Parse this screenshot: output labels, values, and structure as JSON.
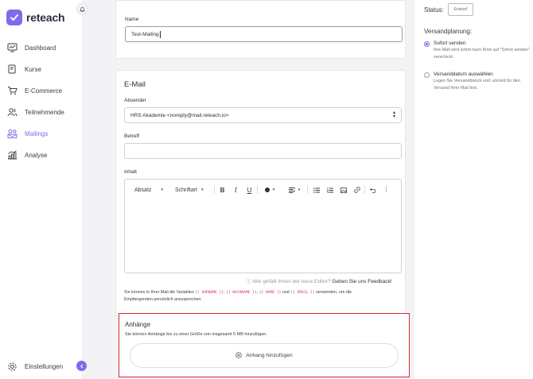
{
  "brand": {
    "name": "reteach"
  },
  "sidebar": {
    "items": [
      {
        "label": "Dashboard",
        "icon": "dashboard-icon"
      },
      {
        "label": "Kurse",
        "icon": "book-icon"
      },
      {
        "label": "E-Commerce",
        "icon": "cart-icon"
      },
      {
        "label": "Teilnehmende",
        "icon": "users-icon"
      },
      {
        "label": "Mailings",
        "icon": "mailings-icon"
      },
      {
        "label": "Analyse",
        "icon": "chart-icon"
      }
    ],
    "active": "Mailings",
    "settings_label": "Einstellungen"
  },
  "form": {
    "name_label": "Name",
    "name_value": "Test-Mailing",
    "email_section_title": "E-Mail",
    "sender_label": "Absender",
    "sender_value": "HRS Akademie <noreply@mail.reteach.io>",
    "subject_label": "Betreff",
    "subject_value": "",
    "content_label": "Inhalt",
    "toolbar": {
      "paragraph": "Absatz",
      "font": "Schriftart"
    },
    "feedback_question": "Wie gefällt Ihnen der neue Editor?",
    "feedback_link": "Geben Sie uns Feedback!",
    "variables": {
      "intro": "Sie können in Ihrer Mail die Variablen",
      "var1": "{{ VORNAME }}",
      "var2": "{{ NACHNAME }}",
      "var3": "{{ NAME }}",
      "and": "und",
      "var4": "{{ EMAIL }}",
      "outro": "verwenden, um die Empfangenden persönlich anzusprechen."
    }
  },
  "attachments": {
    "title": "Anhänge",
    "description": "Sie können Anhänge bis zu einer Größe von insgesamt 5 MB hinzufügen.",
    "add_button": "Anhang hinzufügen"
  },
  "status_panel": {
    "status_label": "Status:",
    "status_value": "Entwurf",
    "planning_title": "Versandplanung:",
    "options": [
      {
        "title": "Sofort senden",
        "description": "Ihre Mail wird sofort nach Klick auf \"Sofort senden\" verschickt.",
        "selected": true
      },
      {
        "title": "Versanddatum auswählen",
        "description": "Legen Sie Versanddatum und -uhrzeit für den Versand Ihrer Mail fest.",
        "selected": false
      }
    ]
  },
  "colors": {
    "accent": "#7b6cf0",
    "highlight_border": "#e0262c",
    "variable_code": "#d6336c",
    "main_background": "#f3f3f6"
  }
}
